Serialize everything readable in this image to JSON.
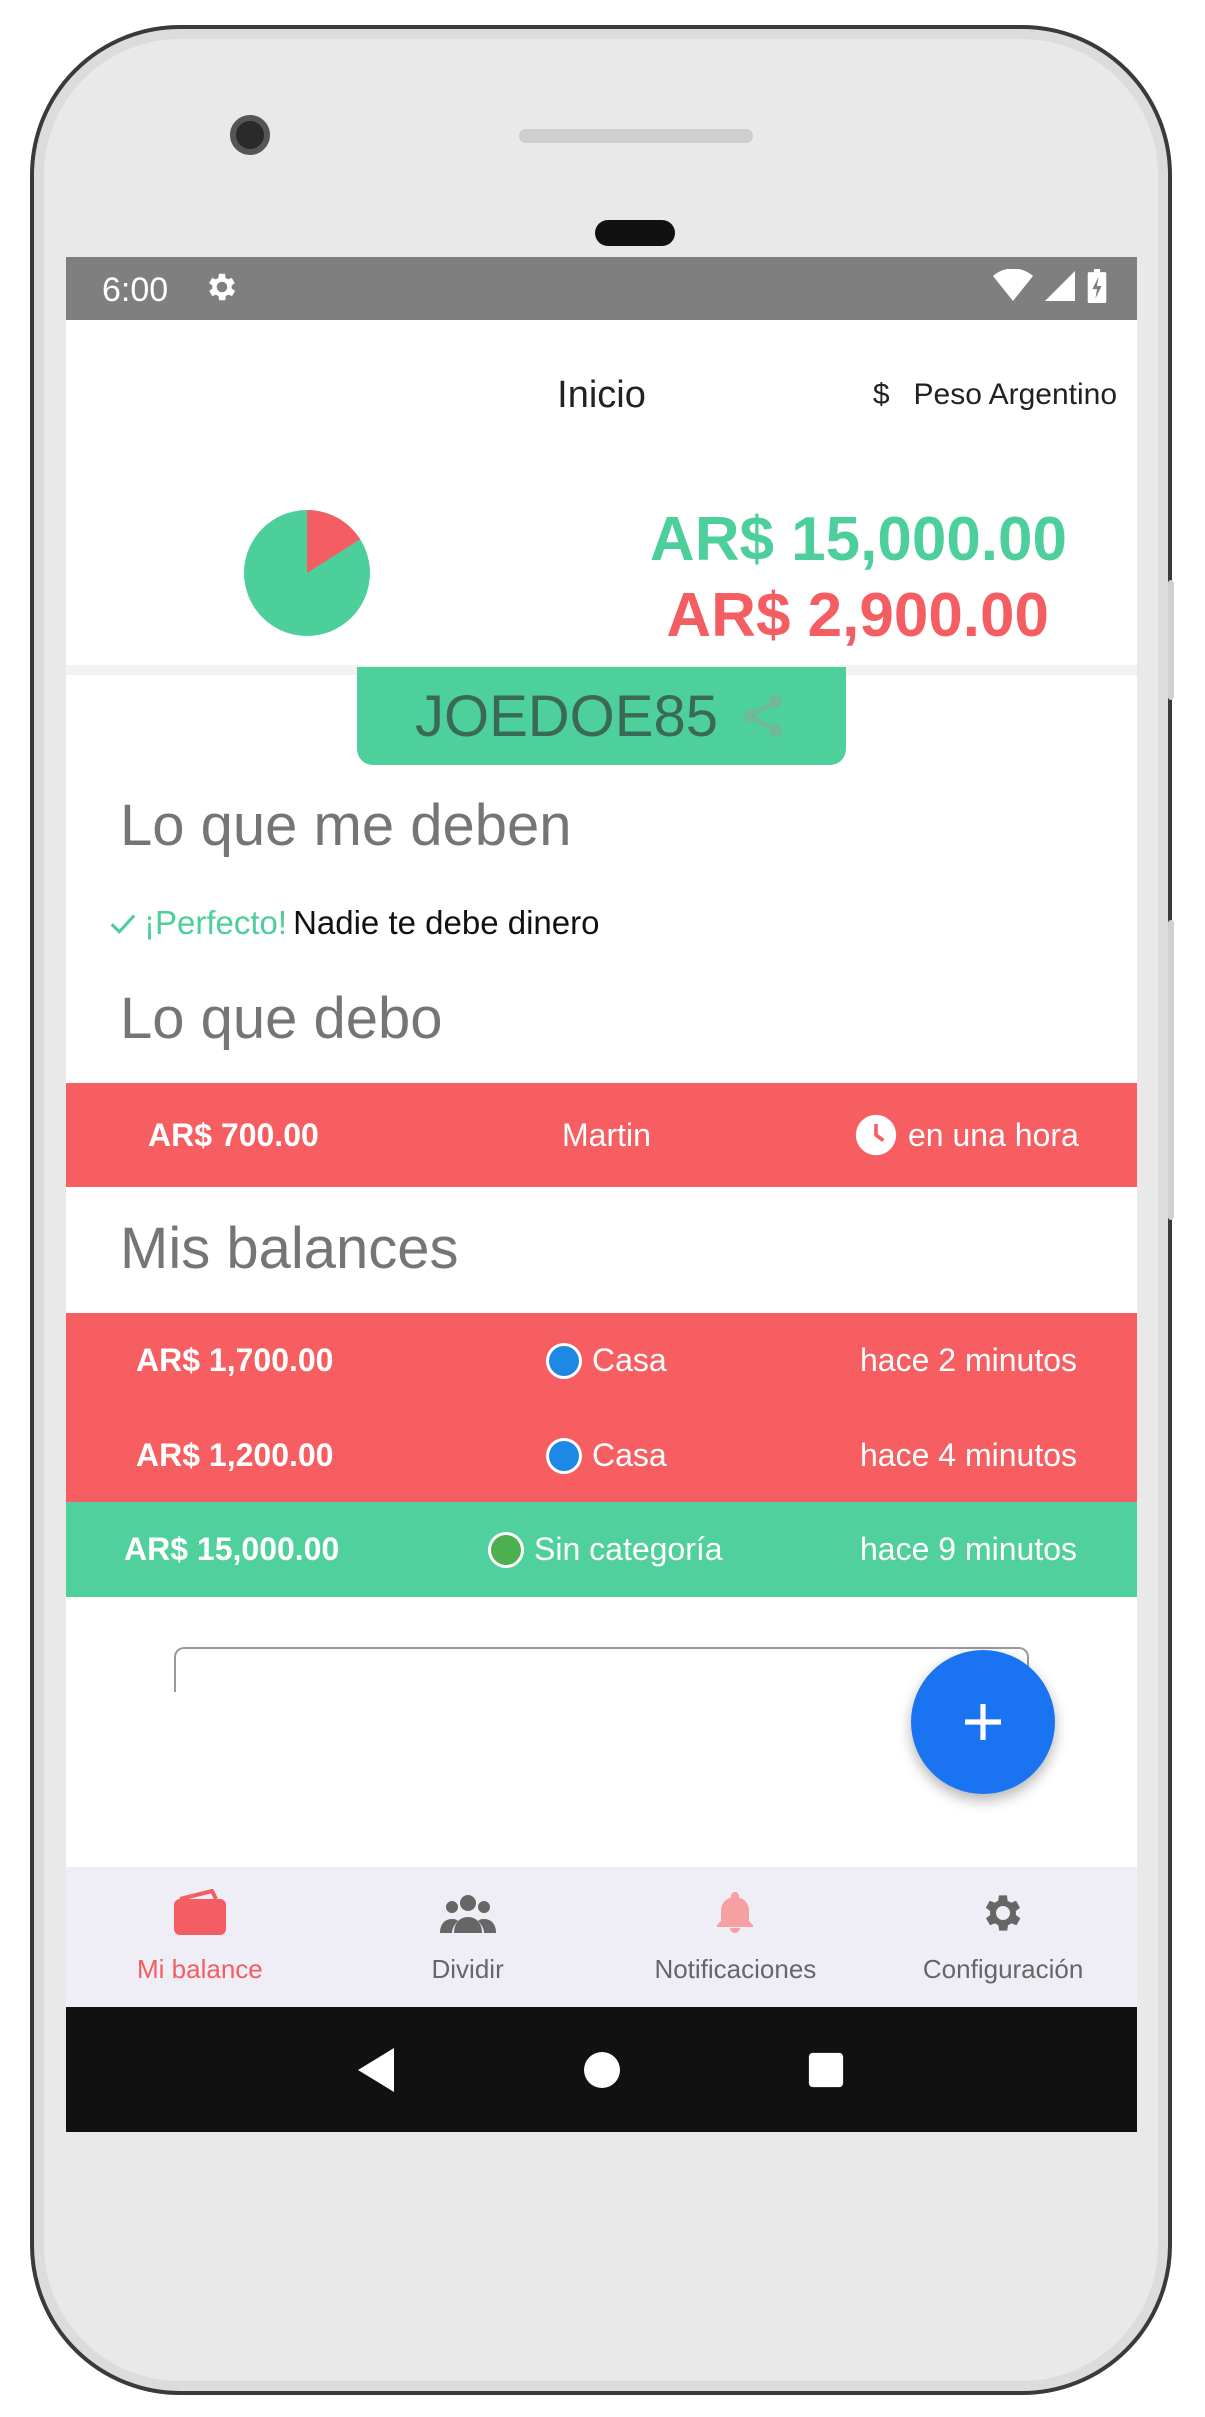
{
  "status": {
    "time": "6:00"
  },
  "header": {
    "title": "Inicio",
    "currency_symbol": "$",
    "currency_label": "Peso Argentino"
  },
  "summary": {
    "owed_to_me": "AR$ 15,000.00",
    "i_owe": "AR$ 2,900.00",
    "pie": {
      "green_fraction": 0.84,
      "red_fraction": 0.16,
      "green": "#4dcf9b",
      "red": "#f45d61"
    }
  },
  "user_code": "JOEDOE85",
  "owed_section": {
    "title": "Lo que me deben",
    "empty_prefix": "¡Perfecto!",
    "empty_text": "Nadie te debe dinero"
  },
  "debts_section": {
    "title": "Lo que debo",
    "rows": [
      {
        "amount": "AR$ 700.00",
        "person": "Martin",
        "time": "en una hora"
      }
    ]
  },
  "balances_section": {
    "title": "Mis balances",
    "rows": [
      {
        "amount": "AR$ 1,700.00",
        "category": "Casa",
        "time": "hace 2 minutos",
        "status": "red",
        "dot_color": "#1e88e5"
      },
      {
        "amount": "AR$ 1,200.00",
        "category": "Casa",
        "time": "hace 4 minutos",
        "status": "red",
        "dot_color": "#1e88e5"
      },
      {
        "amount": "AR$ 15,000.00",
        "category": "Sin categoría",
        "time": "hace 9 minutos",
        "status": "green",
        "dot_color": "#4caf50"
      }
    ]
  },
  "bottom_nav": [
    {
      "label": "Mi balance",
      "icon": "wallet-icon",
      "active": true
    },
    {
      "label": "Dividir",
      "icon": "group-icon",
      "active": false
    },
    {
      "label": "Notificaciones",
      "icon": "bell-icon",
      "active": false
    },
    {
      "label": "Configuración",
      "icon": "gear-icon",
      "active": false
    }
  ],
  "colors": {
    "accent_green": "#4ed09d",
    "accent_red": "#f75e62",
    "fab_blue": "#1a73f0"
  }
}
